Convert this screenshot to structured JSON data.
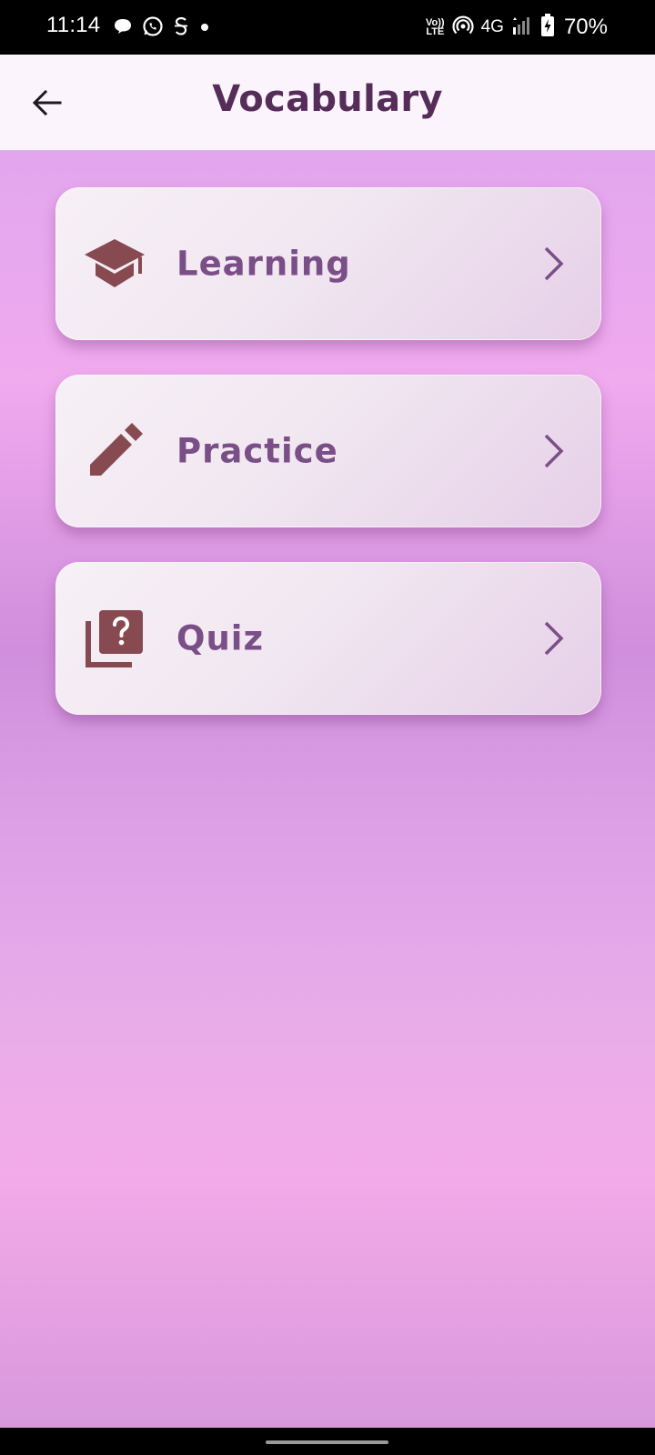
{
  "status_bar": {
    "time": "11:14",
    "notification_icons": [
      "chat-bubble-icon",
      "whatsapp-icon",
      "app-s-icon",
      "dot-icon"
    ],
    "volte_line1": "Vo))",
    "volte_line2": "LTE",
    "network": "4G",
    "battery_percent": "70%",
    "battery_level": 0.7
  },
  "app_bar": {
    "title": "Vocabulary",
    "back_icon": "arrow-left-icon"
  },
  "menu": {
    "items": [
      {
        "label": "Learning",
        "icon": "graduation-cap-icon"
      },
      {
        "label": "Practice",
        "icon": "pencil-icon"
      },
      {
        "label": "Quiz",
        "icon": "quiz-stack-icon"
      }
    ]
  },
  "colors": {
    "title": "#562c59",
    "card_label": "#7a4e86",
    "card_icon": "#874a50",
    "chevron": "#7a4e86",
    "app_bar_bg": "#fbf4fc"
  }
}
